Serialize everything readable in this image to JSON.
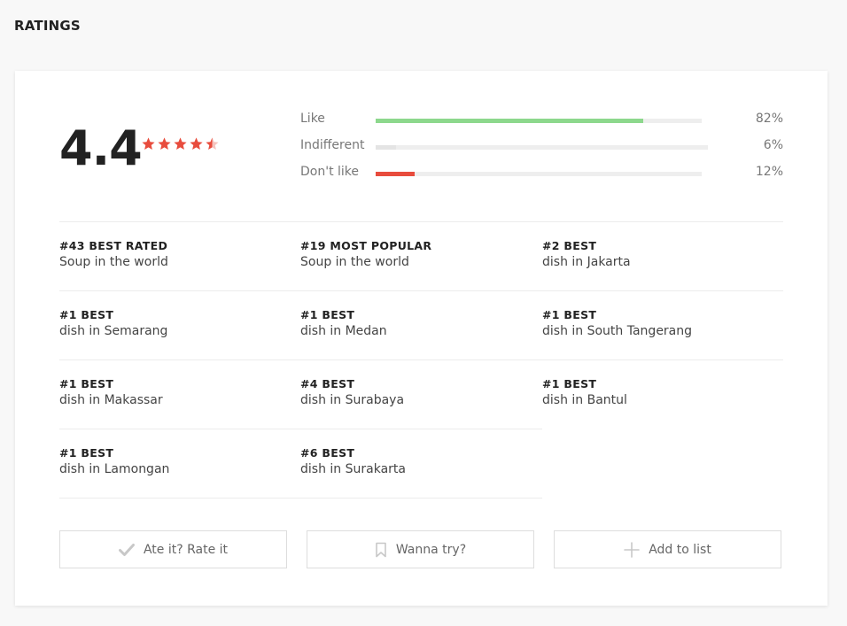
{
  "section": {
    "title": "RATINGS"
  },
  "rating": {
    "score": "4.4",
    "stars": 4.5,
    "max_stars": 5,
    "star_color": "#e84c3d"
  },
  "sentiment": [
    {
      "label": "Like",
      "percent": 82,
      "percent_text": "82%",
      "color": "#8dd88d"
    },
    {
      "label": "Indifferent",
      "percent": 6,
      "percent_text": "6%",
      "color": "#e4e4e4"
    },
    {
      "label": "Don't like",
      "percent": 12,
      "percent_text": "12%",
      "color": "#e84c3d"
    }
  ],
  "rankings": [
    [
      {
        "rank": "#43 BEST RATED",
        "desc": "Soup in the world"
      },
      {
        "rank": "#19 MOST POPULAR",
        "desc": "Soup in the world"
      },
      {
        "rank": "#2 BEST",
        "desc": "dish in Jakarta"
      }
    ],
    [
      {
        "rank": "#1 BEST",
        "desc": "dish in Semarang"
      },
      {
        "rank": "#1 BEST",
        "desc": "dish in Medan"
      },
      {
        "rank": "#1 BEST",
        "desc": "dish in South Tangerang"
      }
    ],
    [
      {
        "rank": "#1 BEST",
        "desc": "dish in Makassar"
      },
      {
        "rank": "#4 BEST",
        "desc": "dish in Surabaya"
      },
      {
        "rank": "#1 BEST",
        "desc": "dish in Bantul"
      }
    ],
    [
      {
        "rank": "#1 BEST",
        "desc": "dish in Lamongan"
      },
      {
        "rank": "#6 BEST",
        "desc": "dish in Surakarta"
      }
    ]
  ],
  "actions": {
    "rate": {
      "label": "Ate it? Rate it",
      "icon": "checkmark-icon"
    },
    "wanna_try": {
      "label": "Wanna try?",
      "icon": "bookmark-icon"
    },
    "add_to_list": {
      "label": "Add to list",
      "icon": "plus-icon"
    }
  }
}
